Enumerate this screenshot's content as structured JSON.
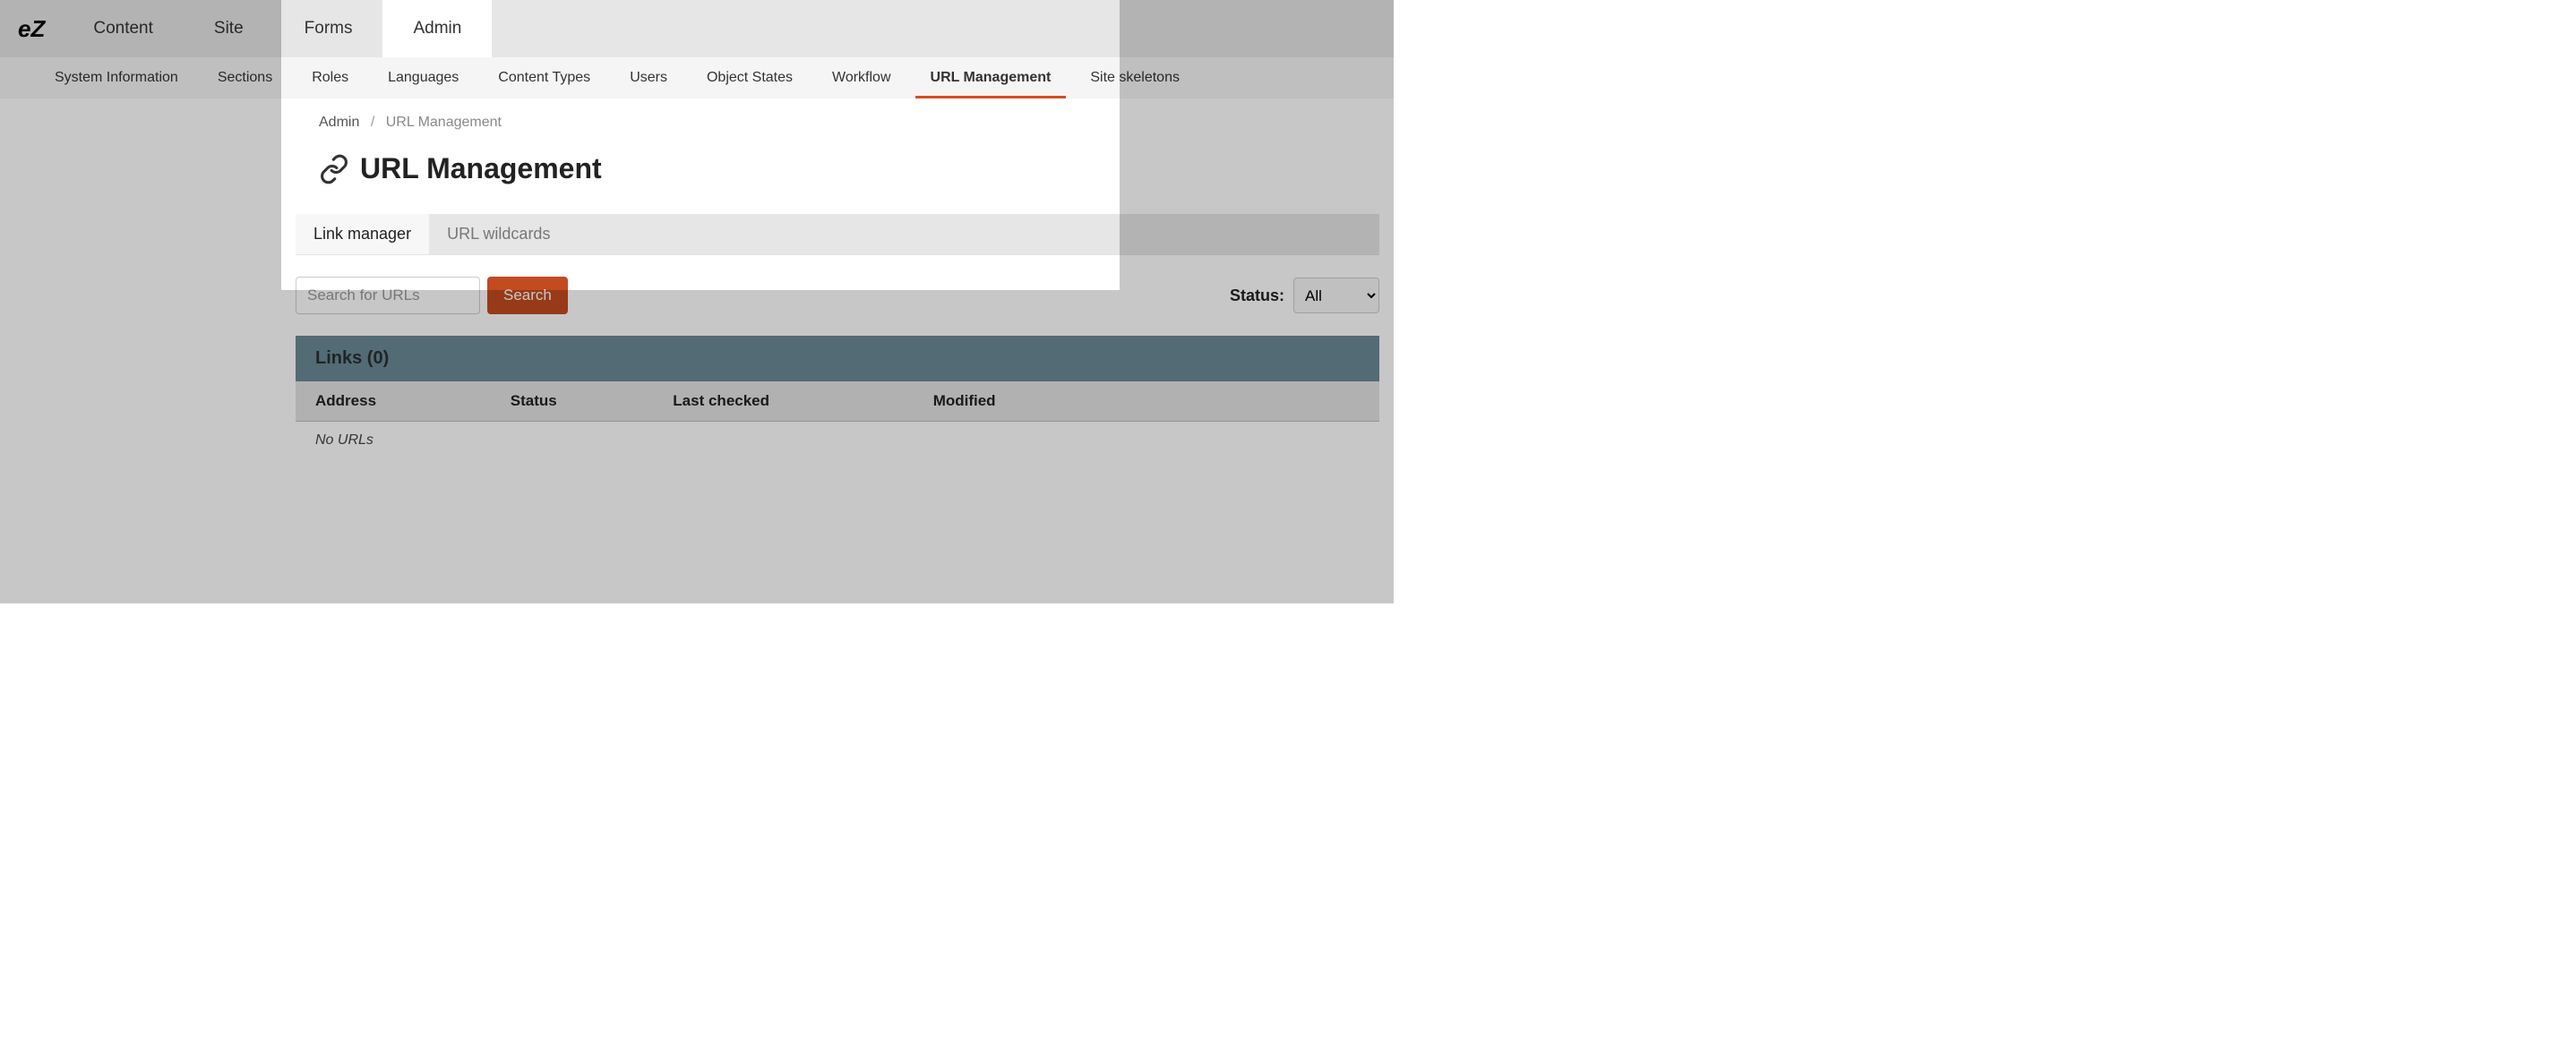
{
  "logo": "eZ",
  "top_nav": {
    "items": [
      {
        "label": "Content",
        "active": false
      },
      {
        "label": "Site",
        "active": false
      },
      {
        "label": "Forms",
        "active": false
      },
      {
        "label": "Admin",
        "active": true
      }
    ]
  },
  "sub_nav": {
    "items": [
      {
        "label": "System Information",
        "active": false
      },
      {
        "label": "Sections",
        "active": false
      },
      {
        "label": "Roles",
        "active": false
      },
      {
        "label": "Languages",
        "active": false
      },
      {
        "label": "Content Types",
        "active": false
      },
      {
        "label": "Users",
        "active": false
      },
      {
        "label": "Object States",
        "active": false
      },
      {
        "label": "Workflow",
        "active": false
      },
      {
        "label": "URL Management",
        "active": true
      },
      {
        "label": "Site skeletons",
        "active": false
      }
    ]
  },
  "breadcrumb": {
    "root": "Admin",
    "separator": "/",
    "current": "URL Management"
  },
  "page": {
    "title": "URL Management"
  },
  "subtabs": {
    "items": [
      {
        "label": "Link manager",
        "active": true
      },
      {
        "label": "URL wildcards",
        "active": false
      }
    ]
  },
  "search": {
    "placeholder": "Search for URLs",
    "value": "",
    "button_label": "Search"
  },
  "filter": {
    "status_label": "Status:",
    "status_value": "All"
  },
  "table": {
    "title": "Links (0)",
    "columns": [
      "Address",
      "Status",
      "Last checked",
      "Modified"
    ],
    "empty_text": "No URLs"
  }
}
